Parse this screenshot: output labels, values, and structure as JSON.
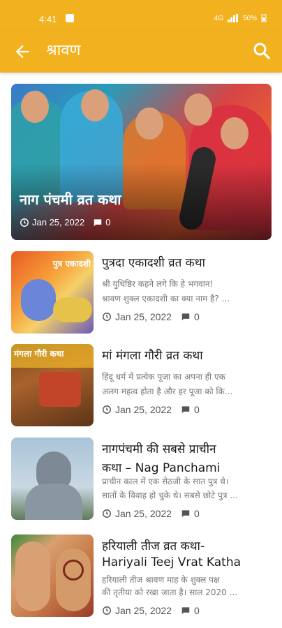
{
  "status_bar": {
    "time": "4:41",
    "network": "4G",
    "battery": "50%"
  },
  "app_bar": {
    "title": "श्रावण"
  },
  "hero": {
    "title": "नाग पंचमी व्रत कथा",
    "date": "Jan 25, 2022",
    "comments": "0"
  },
  "articles": [
    {
      "title": "पुत्रदा एकादशी व्रत कथा",
      "desc1": "श्री युधिष्ठिर कहने लगे कि हे भगवान!",
      "desc2": "श्रावण शुक्ल एकादशी का क्या नाम है? ...",
      "date": "Jan 25, 2022",
      "comments": "0",
      "thumb_text": "पुत्र एकादशी"
    },
    {
      "title": "मां मंगला गौरी व्रत कथा",
      "desc1": "हिंदू धर्म में प्रत्येक पूजा का अपना ही एक",
      "desc2": "अलग महत्व होता है और हर पूजा को कि...",
      "date": "Jan 25, 2022",
      "comments": "0",
      "thumb_text": "मंगला गौरी कथा"
    },
    {
      "title1": "नागपंचमी की सबसे प्राचीन",
      "title2": "कथा – Nag Panchami",
      "desc1": "प्राचीन काल में एक सेठजी के सात पुत्र थे।",
      "desc2": "सातों के विवाह हो चुके थे। सबसे छोटे पुत्र ...",
      "date": "Jan 25, 2022",
      "comments": "0"
    },
    {
      "title1": "हरियाली तीज व्रत कथा-",
      "title2": "Hariyali Teej Vrat Katha",
      "desc1": "हरियाली तीज श्रावण माह के शुक्ल पक्ष",
      "desc2": "की तृतीया को रखा जाता है। साल 2020 ...",
      "date": "Jan 25, 2022",
      "comments": "0"
    }
  ],
  "colors": {
    "accent": "#f2b21f",
    "title_text": "#1a1a1a",
    "desc_text": "#777777"
  },
  "icons": [
    "back-arrow-icon",
    "search-icon",
    "clock-icon",
    "comment-icon"
  ]
}
